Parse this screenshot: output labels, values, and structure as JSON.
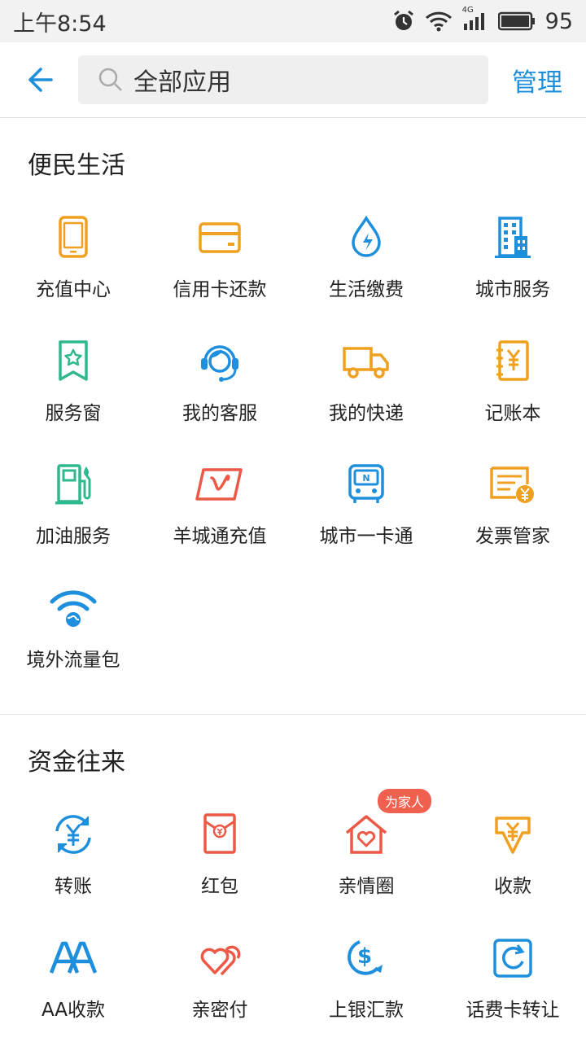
{
  "status": {
    "time": "上午8:54",
    "network": "4G",
    "battery": "95"
  },
  "header": {
    "search_placeholder": "全部应用",
    "manage_label": "管理"
  },
  "sections": [
    {
      "title": "便民生活",
      "apps": [
        {
          "label": "充值中心",
          "icon": "phone-icon"
        },
        {
          "label": "信用卡还款",
          "icon": "credit-card-icon"
        },
        {
          "label": "生活缴费",
          "icon": "water-drop-bolt-icon"
        },
        {
          "label": "城市服务",
          "icon": "building-icon"
        },
        {
          "label": "服务窗",
          "icon": "bookmark-star-icon"
        },
        {
          "label": "我的客服",
          "icon": "headset-agent-icon"
        },
        {
          "label": "我的快递",
          "icon": "delivery-truck-icon"
        },
        {
          "label": "记账本",
          "icon": "ledger-yuan-icon"
        },
        {
          "label": "加油服务",
          "icon": "gas-pump-icon"
        },
        {
          "label": "羊城通充值",
          "icon": "yangchengtong-card-icon"
        },
        {
          "label": "城市一卡通",
          "icon": "bus-card-icon"
        },
        {
          "label": "发票管家",
          "icon": "invoice-icon"
        },
        {
          "label": "境外流量包",
          "icon": "wifi-globe-icon"
        }
      ]
    },
    {
      "title": "资金往来",
      "apps": [
        {
          "label": "转账",
          "icon": "transfer-yuan-icon"
        },
        {
          "label": "红包",
          "icon": "red-envelope-icon"
        },
        {
          "label": "亲情圈",
          "icon": "family-house-heart-icon",
          "badge": "为家人"
        },
        {
          "label": "收款",
          "icon": "receive-money-icon"
        },
        {
          "label": "AA收款",
          "icon": "aa-icon"
        },
        {
          "label": "亲密付",
          "icon": "double-heart-icon"
        },
        {
          "label": "上银汇款",
          "icon": "dollar-remit-icon"
        },
        {
          "label": "话费卡转让",
          "icon": "card-transfer-icon"
        }
      ]
    }
  ],
  "colors": {
    "accent": "#1e8fdc",
    "orange": "#f0a020",
    "green": "#2fb88e",
    "red": "#ec5a47"
  }
}
